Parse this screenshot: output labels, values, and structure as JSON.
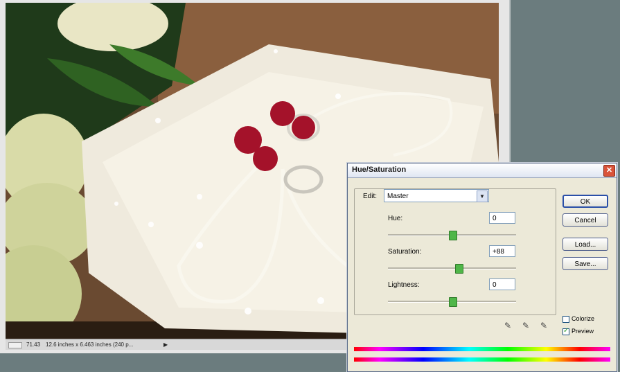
{
  "status_bar": {
    "zoom": "71.43",
    "doc_info": "12.6 inches x 6.463 inches (240 p..."
  },
  "dialog": {
    "title": "Hue/Saturation",
    "edit_label": "Edit:",
    "edit_value": "Master",
    "hue": {
      "label": "Hue:",
      "value": "0",
      "slider_fraction": 0.5
    },
    "saturation": {
      "label": "Saturation:",
      "value": "+88",
      "slider_fraction": 0.56
    },
    "lightness": {
      "label": "Lightness:",
      "value": "0",
      "slider_fraction": 0.5
    },
    "buttons": {
      "ok": "OK",
      "cancel": "Cancel",
      "load": "Load...",
      "save": "Save..."
    },
    "colorize": {
      "label": "Colorize",
      "checked": false
    },
    "preview": {
      "label": "Preview",
      "checked": true
    }
  },
  "colors": {
    "workspace": "#6b7c7e",
    "dialog_bg": "#ece9d8",
    "slider_thumb": "#4fb648",
    "close_button": "#d9533a"
  },
  "icons": [
    "close-icon",
    "dropdown-arrow-icon",
    "eyedropper-icon",
    "eyedropper-plus-icon",
    "eyedropper-minus-icon"
  ]
}
